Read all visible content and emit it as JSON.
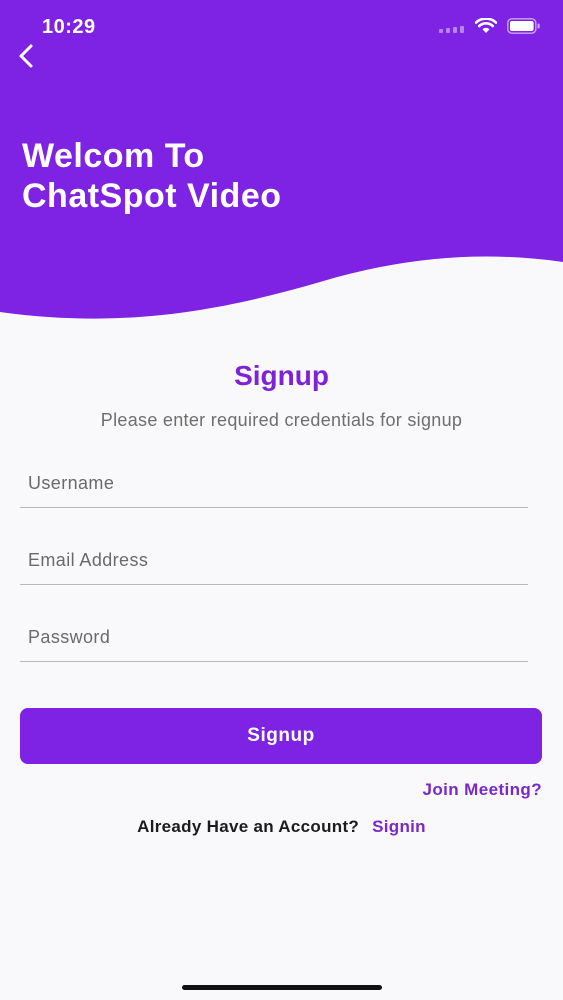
{
  "status_bar": {
    "time": "10:29"
  },
  "icons": {
    "back": "chevron-left-icon",
    "signal": "cellular-signal-icon",
    "wifi": "wifi-icon",
    "battery": "battery-icon"
  },
  "header": {
    "title_line1": "Welcom To",
    "title_line2": "ChatSpot Video"
  },
  "form": {
    "title": "Signup",
    "subtitle": "Please enter required credentials for signup",
    "username_placeholder": "Username",
    "email_placeholder": "Email Address",
    "password_placeholder": "Password",
    "submit_label": "Signup",
    "join_meeting_label": "Join Meeting?",
    "account_prompt": "Already Have an Account?",
    "signin_label": "Signin"
  },
  "colors": {
    "brand_purple": "#7e22e4",
    "link_purple": "#7a28c8",
    "background": "#f9f9fb"
  }
}
